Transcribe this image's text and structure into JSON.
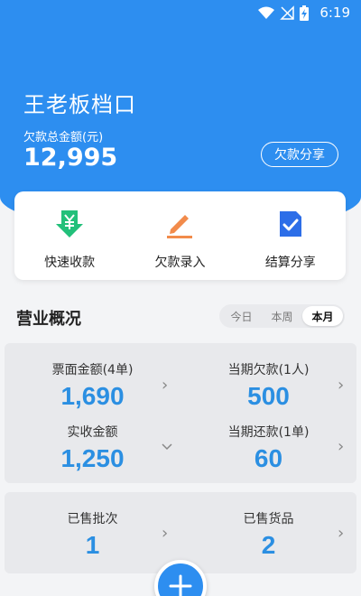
{
  "status_bar": {
    "time": "6:19"
  },
  "header": {
    "shop_name": "王老板档口",
    "debt_label": "欠款总金额(元)",
    "debt_total": "12,995",
    "share_button": "欠款分享"
  },
  "actions": [
    {
      "label": "快速收款",
      "icon": "yen-download-icon",
      "color": "#22c07a"
    },
    {
      "label": "欠款录入",
      "icon": "pencil-edit-icon",
      "color": "#f28b4b"
    },
    {
      "label": "结算分享",
      "icon": "document-check-icon",
      "color": "#2d6ee8"
    }
  ],
  "overview": {
    "title": "营业概况",
    "tabs": [
      "今日",
      "本周",
      "本月"
    ],
    "active_tab": "本月"
  },
  "stats": {
    "face_amount": {
      "label": "票面金额(4单)",
      "value": "1,690"
    },
    "period_debt": {
      "label": "当期欠款(1人)",
      "value": "500"
    },
    "received": {
      "label": "实收金额",
      "value": "1,250"
    },
    "period_repay": {
      "label": "当期还款(1单)",
      "value": "60"
    },
    "batches_sold": {
      "label": "已售批次",
      "value": "1"
    },
    "goods_sold": {
      "label": "已售货品",
      "value": "2"
    }
  },
  "colors": {
    "primary": "#2d8ef0",
    "value_blue": "#2b8fe2"
  }
}
